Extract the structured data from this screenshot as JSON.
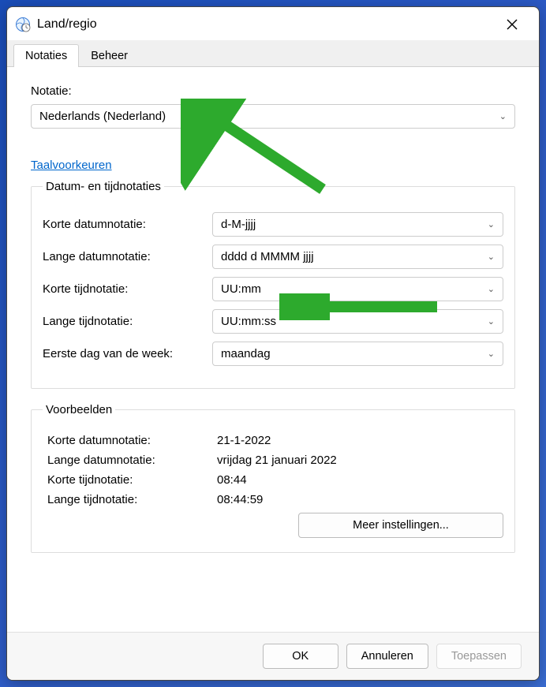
{
  "window": {
    "title": "Land/regio"
  },
  "tabs": {
    "notaties": "Notaties",
    "beheer": "Beheer"
  },
  "format": {
    "label": "Notatie:",
    "value": "Nederlands (Nederland)"
  },
  "link": {
    "language_prefs": "Taalvoorkeuren"
  },
  "datetime_section": {
    "legend": "Datum- en tijdnotaties",
    "short_date_label": "Korte datumnotatie:",
    "short_date_value": "d-M-jjjj",
    "long_date_label": "Lange datumnotatie:",
    "long_date_value": "dddd d MMMM jjjj",
    "short_time_label": "Korte tijdnotatie:",
    "short_time_value": "UU:mm",
    "long_time_label": "Lange tijdnotatie:",
    "long_time_value": "UU:mm:ss",
    "first_day_label": "Eerste dag van de week:",
    "first_day_value": "maandag"
  },
  "examples": {
    "legend": "Voorbeelden",
    "short_date_label": "Korte datumnotatie:",
    "short_date_value": "21-1-2022",
    "long_date_label": "Lange datumnotatie:",
    "long_date_value": "vrijdag 21 januari 2022",
    "short_time_label": "Korte tijdnotatie:",
    "short_time_value": "08:44",
    "long_time_label": "Lange tijdnotatie:",
    "long_time_value": "08:44:59"
  },
  "buttons": {
    "more_settings": "Meer instellingen...",
    "ok": "OK",
    "cancel": "Annuleren",
    "apply": "Toepassen"
  },
  "annotation": {
    "arrow_color": "#2DAA2D"
  }
}
